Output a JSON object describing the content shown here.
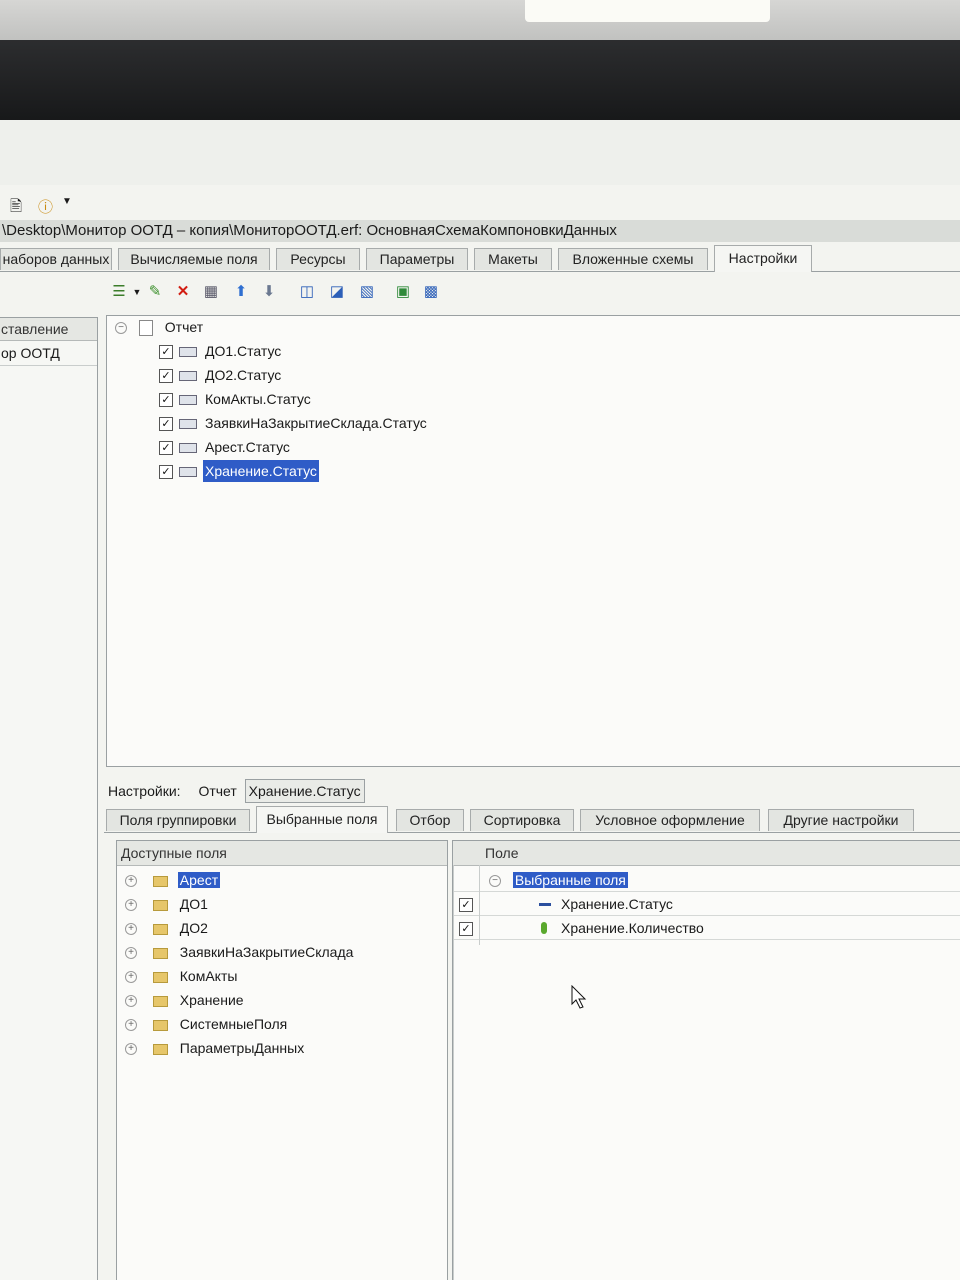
{
  "window": {
    "title": "\\Desktop\\Монитор ООТД – копия\\МониторООТД.erf: ОсновнаяСхемаКомпоновкиДанных"
  },
  "tabs": [
    {
      "label": "наборов данных"
    },
    {
      "label": "Вычисляемые поля"
    },
    {
      "label": "Ресурсы"
    },
    {
      "label": "Параметры"
    },
    {
      "label": "Макеты"
    },
    {
      "label": "Вложенные схемы"
    },
    {
      "label": "Настройки",
      "active": true
    }
  ],
  "left_panel": {
    "header": "ставление",
    "items": [
      "ор ООТД"
    ]
  },
  "structure_tree": {
    "root": "Отчет",
    "items": [
      {
        "label": "ДО1.Статус",
        "checked": true
      },
      {
        "label": "ДО2.Статус",
        "checked": true
      },
      {
        "label": "КомАкты.Статус",
        "checked": true
      },
      {
        "label": "ЗаявкиНаЗакрытиеСклада.Статус",
        "checked": true
      },
      {
        "label": "Арест.Статус",
        "checked": true
      },
      {
        "label": "Хранение.Статус",
        "checked": true,
        "selected": true
      }
    ]
  },
  "settings_path": {
    "label": "Настройки:",
    "root": "Отчет",
    "current": "Хранение.Статус"
  },
  "settings_tabs": [
    {
      "label": "Поля группировки"
    },
    {
      "label": "Выбранные поля",
      "active": true
    },
    {
      "label": "Отбор"
    },
    {
      "label": "Сортировка"
    },
    {
      "label": "Условное оформление"
    },
    {
      "label": "Другие настройки"
    }
  ],
  "available_fields": {
    "header": "Доступные поля",
    "items": [
      {
        "label": "Арест",
        "selected": true
      },
      {
        "label": "ДО1"
      },
      {
        "label": "ДО2"
      },
      {
        "label": "ЗаявкиНаЗакрытиеСклада"
      },
      {
        "label": "КомАкты"
      },
      {
        "label": "Хранение"
      },
      {
        "label": "СистемныеПоля"
      },
      {
        "label": "ПараметрыДанных"
      }
    ]
  },
  "selected_fields": {
    "header": "Поле",
    "group": "Выбранные поля",
    "items": [
      {
        "label": "Хранение.Статус",
        "checked": true
      },
      {
        "label": "Хранение.Количество",
        "checked": true
      }
    ]
  },
  "colors": {
    "selection": "#2f5cc7",
    "folder": "#e6c66a"
  }
}
